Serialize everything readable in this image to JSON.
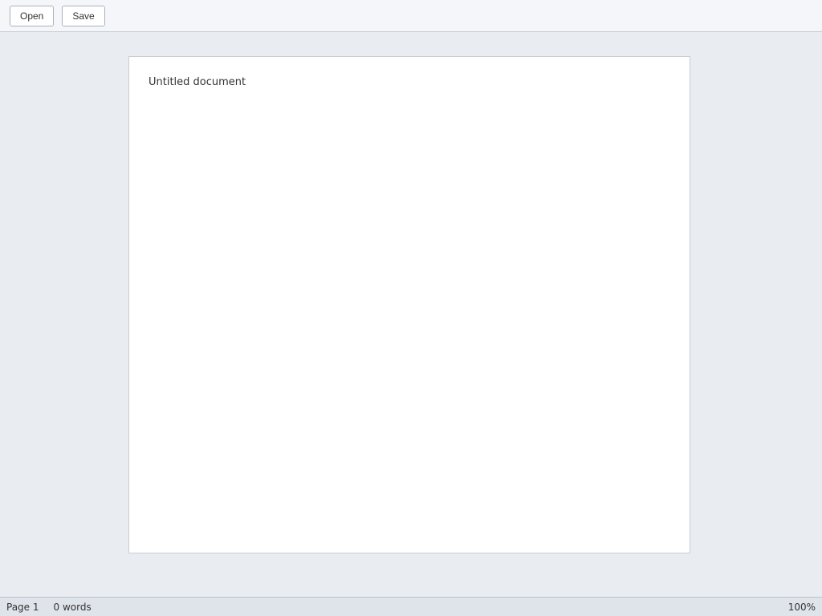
{
  "toolbar": {
    "open_label": "Open",
    "save_label": "Save"
  },
  "document": {
    "body_text": "Untitled document"
  },
  "status": {
    "page": "Page 1",
    "words": "0 words",
    "zoom": "100%"
  }
}
